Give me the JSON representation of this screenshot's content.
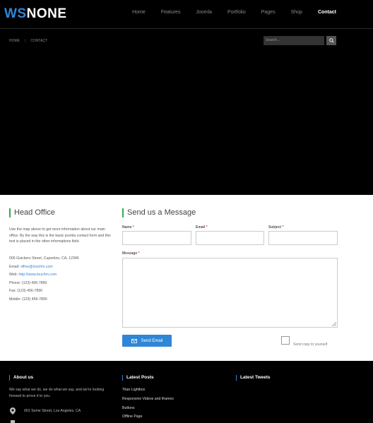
{
  "header": {
    "logo_ws": "WS",
    "logo_none": "NONE",
    "nav": [
      "Home",
      "Features",
      "Joomla",
      "Portfolio",
      "Pages",
      "Shop",
      "Contact"
    ],
    "active_nav": "Contact"
  },
  "breadcrumb": {
    "home": "HOME",
    "sep": "|",
    "current": "CONTACT"
  },
  "search": {
    "placeholder": "Search..."
  },
  "head_office": {
    "title": "Head Office",
    "description": "Use the map above to get more information about our main office. By the way this is the basic joomla contact form and this text is placed in the other informations field.",
    "address": "005 Guickers Street, Cupertino, CA, 12345",
    "email_label": "Email:",
    "email": "office@touchm.com",
    "web_label": "Web:",
    "web": "http://www.touchm.com",
    "phone": "Phone: (123) 456-7890",
    "fax": "Fax: (123) 456-7890",
    "mobile": "Mobile: (123) 456-7890"
  },
  "message_form": {
    "title": "Send us a Message",
    "name_label": "Name",
    "email_label": "Email",
    "subject_label": "Subject",
    "message_label": "Message",
    "required_mark": "*",
    "send_label": "Send Email",
    "copy_label": "Send copy to yourself"
  },
  "footer": {
    "about_title": "About us",
    "about_text": "We say what we do, we do what we say, and we're looking forward to prove it to you.",
    "about_address": "001 Some Street, Los Angeles, CA",
    "posts_title": "Latest Posts",
    "posts": [
      "Titan Lightbox",
      "Responsive Videos and iframes",
      "Buttons",
      "Offline Page"
    ],
    "tweets_title": "Latest Tweets"
  }
}
